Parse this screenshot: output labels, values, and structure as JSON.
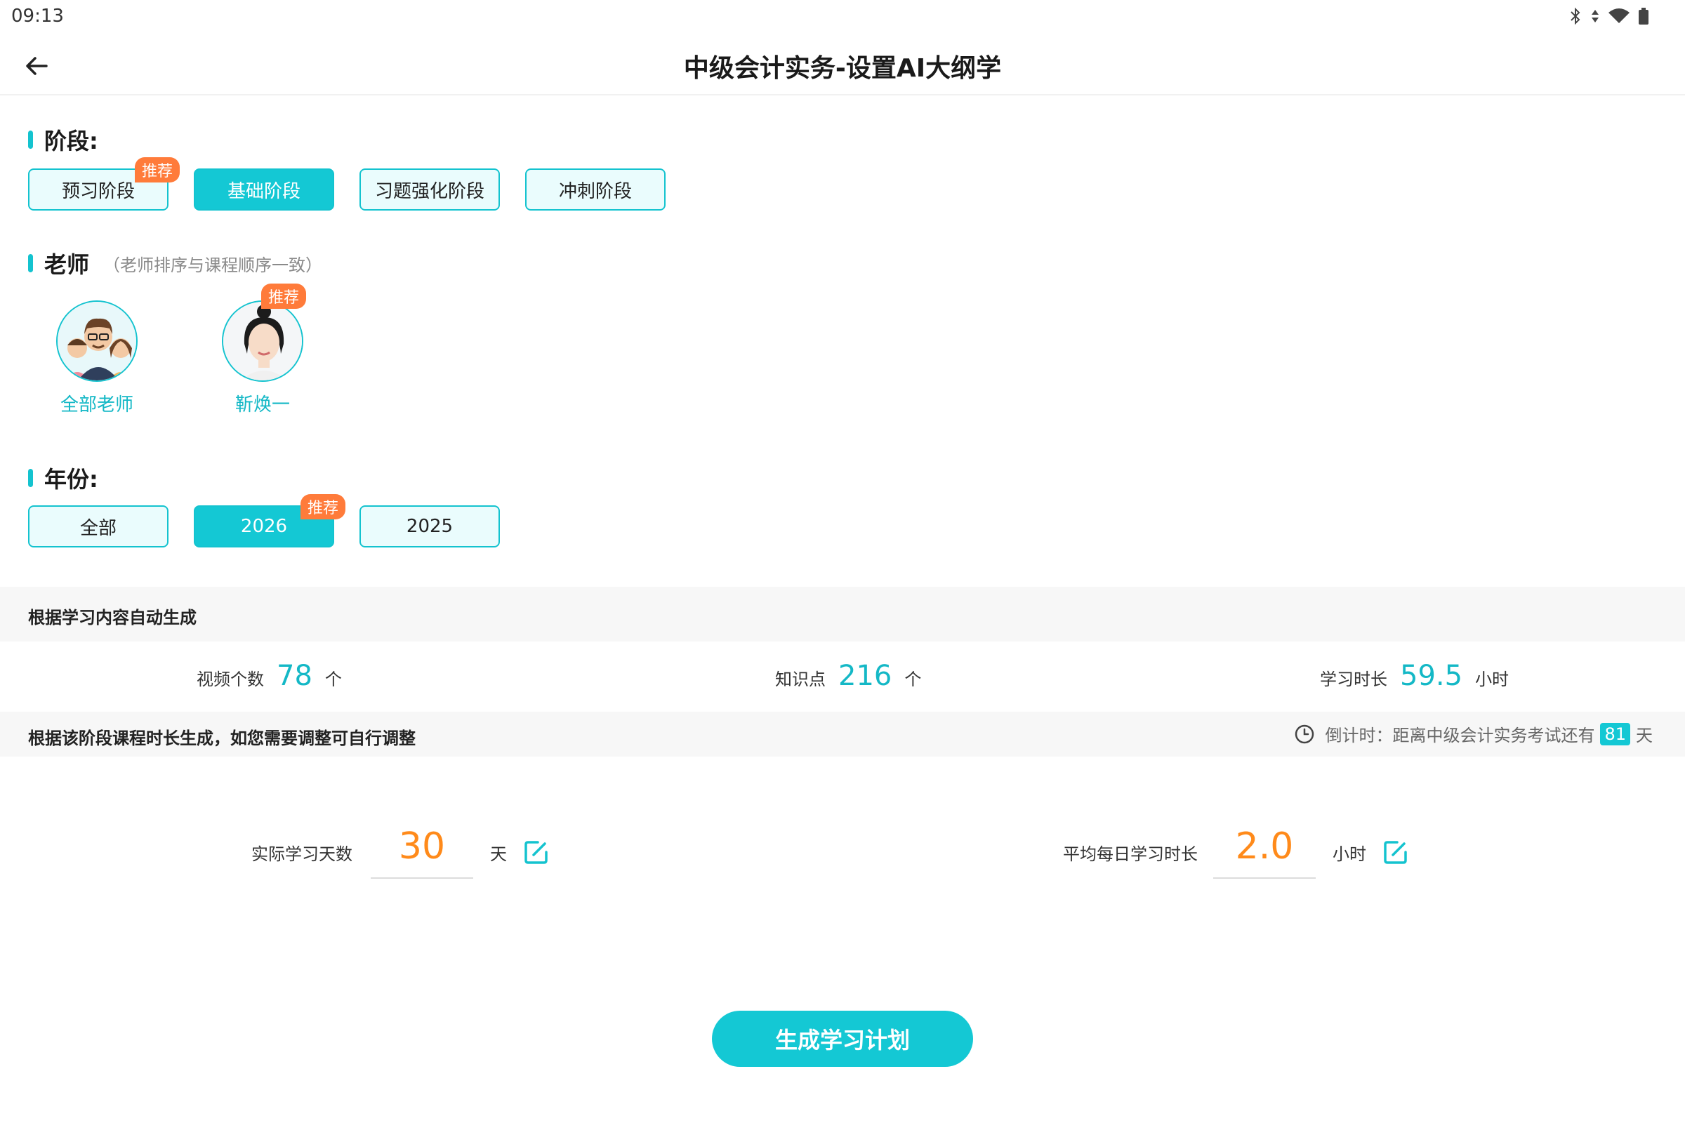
{
  "status_bar": {
    "time": "09:13",
    "icons": [
      "bluetooth-icon",
      "signal-icon",
      "wifi-icon",
      "battery-icon"
    ]
  },
  "header": {
    "title": "中级会计实务-设置AI大纲学",
    "back_icon": "arrow-left-icon"
  },
  "stage": {
    "title": "阶段:",
    "options": [
      {
        "label": "预习阶段",
        "badge": "推荐",
        "selected": false
      },
      {
        "label": "基础阶段",
        "selected": true
      },
      {
        "label": "习题强化阶段",
        "selected": false
      },
      {
        "label": "冲刺阶段",
        "selected": false
      }
    ]
  },
  "teacher": {
    "title": "老师",
    "hint": "（老师排序与课程顺序一致）",
    "items": [
      {
        "name": "全部老师",
        "avatar": "group-avatar-icon"
      },
      {
        "name": "靳焕一",
        "badge": "推荐",
        "avatar": "teacher-avatar-icon"
      }
    ]
  },
  "year": {
    "title": "年份:",
    "options": [
      {
        "label": "全部",
        "selected": false
      },
      {
        "label": "2026",
        "badge": "推荐",
        "selected": true
      },
      {
        "label": "2025",
        "selected": false
      }
    ]
  },
  "auto_section": {
    "title": "根据学习内容自动生成",
    "stats": [
      {
        "label": "视频个数",
        "value": "78",
        "unit": "个"
      },
      {
        "label": "知识点",
        "value": "216",
        "unit": "个"
      },
      {
        "label": "学习时长",
        "value": "59.5",
        "unit": "小时"
      }
    ]
  },
  "adjust_section": {
    "title": "根据该阶段课程时长生成，如您需要调整可自行调整",
    "countdown_prefix": "倒计时：距离中级会计实务考试还有",
    "countdown_days": "81",
    "countdown_suffix": "天",
    "days": {
      "label": "实际学习天数",
      "value": "30",
      "unit": "天"
    },
    "daily": {
      "label": "平均每日学习时长",
      "value": "2.0",
      "unit": "小时"
    }
  },
  "generate_button": "生成学习计划",
  "colors": {
    "accent": "#14c8d4",
    "badge": "#ff7b3a",
    "value_orange": "#ff8a1a"
  }
}
